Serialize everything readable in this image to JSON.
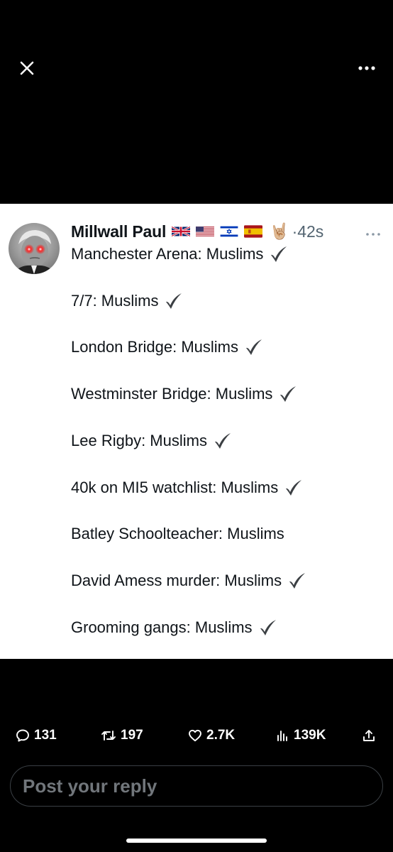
{
  "top_bar": {
    "close_icon": "close-icon",
    "more_icon": "more-horizontal-icon"
  },
  "tweet": {
    "author_name": "Millwall Paul",
    "badges": [
      "uk-flag",
      "us-flag",
      "israel-flag",
      "spain-flag"
    ],
    "hand_emoji": "🤘🏼",
    "time": "·42s",
    "lines": [
      {
        "text": "Manchester Arena: Muslims",
        "check": true
      },
      {
        "text": "7/7: Muslims",
        "check": true
      },
      {
        "text": "London Bridge: Muslims",
        "check": true
      },
      {
        "text": "Westminster Bridge: Muslims",
        "check": true
      },
      {
        "text": "Lee Rigby: Muslims",
        "check": true
      },
      {
        "text": "40k on MI5 watchlist: Muslims",
        "check": true
      },
      {
        "text": "Batley Schoolteacher: Muslims",
        "check": false
      },
      {
        "text": "David Amess murder: Muslims",
        "check": true
      },
      {
        "text": "Grooming gangs: Muslims",
        "check": true
      }
    ]
  },
  "actions": {
    "replies": "131",
    "reposts": "197",
    "likes": "2.7K",
    "views": "139K"
  },
  "reply": {
    "placeholder": "Post your reply"
  },
  "colors": {
    "background": "#000000",
    "card": "#ffffff",
    "text": "#0f1419",
    "muted": "#536471",
    "reply_border": "#3a3f44",
    "check": "#3b3f43"
  }
}
